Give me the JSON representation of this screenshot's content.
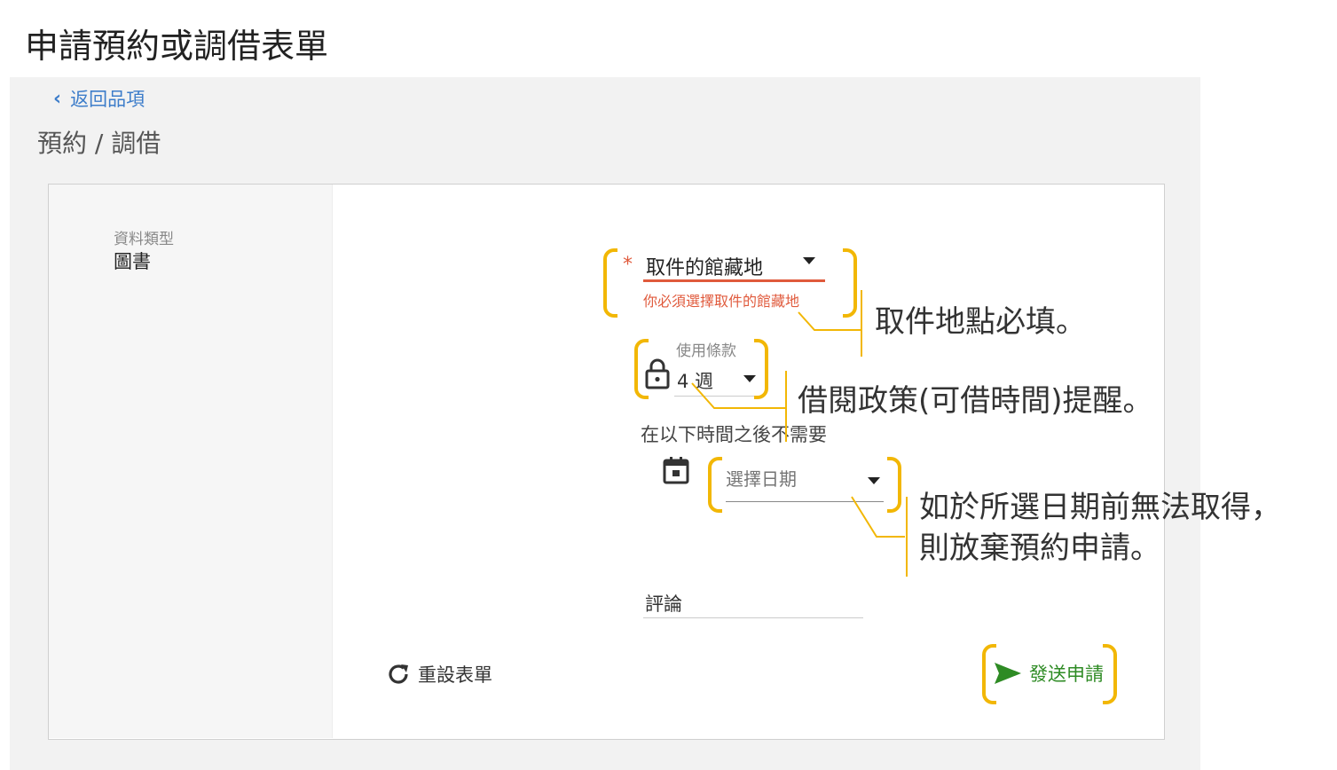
{
  "page": {
    "title": "申請預約或調借表單"
  },
  "nav": {
    "back_label": "返回品項",
    "breadcrumb": "預約 / 調借"
  },
  "record": {
    "type_label": "資料類型",
    "type_value": "圖書"
  },
  "form": {
    "pickup": {
      "required_mark": "*",
      "label": "取件的館藏地",
      "error": "你必須選擇取件的館藏地"
    },
    "terms": {
      "label": "使用條款",
      "value": "4 週"
    },
    "not_needed_after": {
      "label": "在以下時間之後不需要",
      "placeholder": "選擇日期"
    },
    "comment": {
      "label": "評論"
    },
    "reset_label": "重設表單",
    "submit_label": "發送申請"
  },
  "annotations": {
    "pickup_note": "取件地點必填。",
    "terms_note": "借閱政策(可借時間)提醒。",
    "date_note_line1": "如於所選日期前無法取得，",
    "date_note_line2": "則放棄預約申請。"
  },
  "colors": {
    "accent_link": "#3d7dca",
    "error": "#e05a3c",
    "submit": "#2e8b24",
    "annotation": "#f2b705"
  }
}
